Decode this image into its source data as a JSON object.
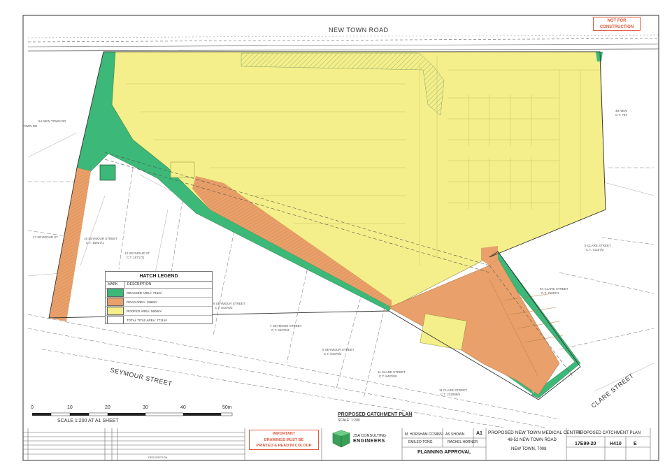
{
  "road_label": "NEW TOWN ROAD",
  "stamp": {
    "line1": "NOT FOR",
    "line2": "CONSTRUCTION"
  },
  "street_labels": {
    "seymour_street": "SEYMOUR STREET",
    "clare_street": "CLARE STREET"
  },
  "lot_labels": [
    {
      "a": "54 NEW TOWN RD",
      "b": ""
    },
    {
      "a": "17 SEYMOUR ST",
      "b": ""
    },
    {
      "a": "15 SEYMOUR STREET",
      "b": "C.T. 16927/1"
    },
    {
      "a": "13 SEYMOUR ST",
      "b": "C.T. 16717/1"
    },
    {
      "a": "9 SEYMOUR STREET",
      "b": "C.T. 84376/2"
    },
    {
      "a": "7 SEYMOUR STREET",
      "b": "C.T. 84376/3"
    },
    {
      "a": "5 SEYMOUR STREET",
      "b": "C.T. 84376/4"
    },
    {
      "a": "11 CLARE STREET",
      "b": "C.T. 84376/5"
    },
    {
      "a": "11 CLARE STREET",
      "b": "C.T. 222085/6"
    },
    {
      "a": "9A CLARE STREET",
      "b": "C.T. 71207/1"
    },
    {
      "a": "9 CLARE STREET",
      "b": "C.T. 71207/2"
    },
    {
      "a": "48 NEW",
      "b": "C.T. 764"
    },
    {
      "a": "TOWN RD",
      "b": ""
    }
  ],
  "legend": {
    "title": "HATCH LEGEND",
    "col_mark": "MARK",
    "col_desc": "DESCRIPTION",
    "items": [
      {
        "label": "GRASSED AREA: 716m²",
        "color": "#3cb878"
      },
      {
        "label": "ROAD AREA: 1968m²",
        "color": "#e9a06a"
      },
      {
        "label": "ROOFED AREA: 5600m²",
        "color": "#f4ef8a"
      },
      {
        "label": "TOTAL TITLE AREA: 7711m²",
        "color": "#ffffff"
      }
    ]
  },
  "plan_title": "PROPOSED CATCHMENT PLAN",
  "plan_scale": "SCALE: 1:200",
  "scale_bar": {
    "ticks": [
      "0",
      "10",
      "20",
      "30",
      "40",
      "50m"
    ],
    "note": "SCALE 1:200 AT A1 SHEET"
  },
  "titleblock": {
    "important_l1": "IMPORTANT",
    "important_l2": "DRAWINGS MUST BE",
    "important_l3": "PRINTED & READ IN COLOUR",
    "company_l1": "JSA CONSULTING",
    "company_l2": "ENGINEERS",
    "drawn": "M. HORSHAM CCS8651",
    "designed": "EMILEO TONG",
    "scale": "AS SHOWN",
    "size": "A1",
    "principal": "RACHEL HORNER",
    "status": "PLANNING APPROVAL",
    "project_l1": "PROPOSED NEW TOWN MEDICAL CENTRE",
    "project_l2": "48-52 NEW TOWN ROAD",
    "project_l3": "NEW TOWN, 7008",
    "drawing_title": "PROPOSED CATCHMENT PLAN",
    "project_no": "17E99-20",
    "drawing_no": "H410",
    "revision": "E",
    "col_description": "DESCRIPTION"
  },
  "colors": {
    "roofed": "#f4ef8a",
    "road": "#e9a06a",
    "grassed": "#3cb878",
    "stamp": "#e05a3c"
  }
}
